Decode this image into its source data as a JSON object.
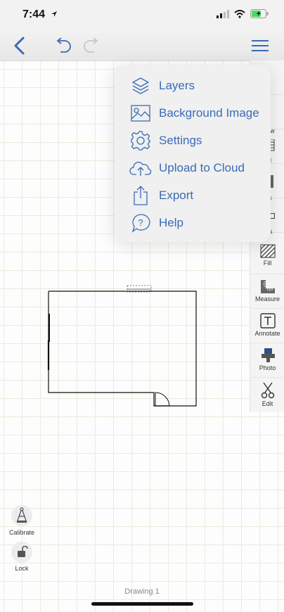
{
  "status": {
    "time": "7:44"
  },
  "nav": {
    "back_icon": "chevron-left-icon",
    "undo_icon": "undo-icon",
    "redo_icon": "redo-icon",
    "menu_icon": "hamburger-icon"
  },
  "menu": {
    "items": [
      {
        "label": "Layers",
        "icon": "layers-icon"
      },
      {
        "label": "Background Image",
        "icon": "image-icon"
      },
      {
        "label": "Settings",
        "icon": "gear-icon"
      },
      {
        "label": "Upload to Cloud",
        "icon": "cloud-upload-icon"
      },
      {
        "label": "Export",
        "icon": "share-icon"
      },
      {
        "label": "Help",
        "icon": "help-bubble-icon"
      }
    ]
  },
  "toolbar": {
    "partial_labels": [
      "ct",
      "w",
      "l",
      "ngs",
      "es"
    ],
    "tools": [
      {
        "label": "Fill"
      },
      {
        "label": "Measure"
      },
      {
        "label": "Annotate"
      },
      {
        "label": "Photo"
      },
      {
        "label": "Edit"
      }
    ]
  },
  "side": {
    "calibrate": "Calibrate",
    "lock": "Lock"
  },
  "footer": {
    "drawing_name": "Drawing 1"
  },
  "colors": {
    "accent": "#3a6ab8",
    "grid": "#ecebdc",
    "menu_bg": "#f0f0f0"
  }
}
